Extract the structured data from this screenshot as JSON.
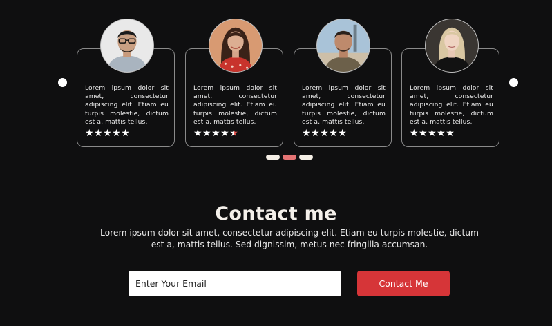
{
  "testimonials": [
    {
      "avatar_icon": "person-glasses-avatar",
      "text": "Lorem ipsum dolor sit amet, consectetur adipiscing elit. Etiam eu turpis molestie, dictum est a, mattis tellus.",
      "rating": 5,
      "stars": "★★★★★"
    },
    {
      "avatar_icon": "woman-avatar",
      "text": "Lorem ipsum dolor sit amet, consectetur adipiscing elit. Etiam eu turpis molestie, dictum est a, mattis tellus.",
      "rating": 4.5,
      "stars": "★★★★"
    },
    {
      "avatar_icon": "man-beach-avatar",
      "text": "Lorem ipsum dolor sit amet, consectetur adipiscing elit. Etiam eu turpis molestie, dictum est a, mattis tellus.",
      "rating": 5,
      "stars": "★★★★★"
    },
    {
      "avatar_icon": "blonde-woman-avatar",
      "text": "Lorem ipsum dolor sit amet, consectetur adipiscing elit. Etiam eu turpis molestie, dictum est a, mattis tellus.",
      "rating": 5,
      "stars": "★★★★★"
    }
  ],
  "half_star": "★",
  "pager": {
    "count": 3,
    "active_index": 1
  },
  "contact": {
    "title": "Contact me",
    "description": "Lorem ipsum dolor sit amet, consectetur adipiscing elit. Etiam eu turpis molestie, dictum est a, mattis tellus. Sed dignissim, metus nec fringilla accumsan.",
    "email_placeholder": "Enter Your Email",
    "button_label": "Contact Me"
  },
  "colors": {
    "background": "#0f0f10",
    "accent": "#d63538",
    "pager_active": "#e57474",
    "pager_inactive": "#f5efe6"
  }
}
